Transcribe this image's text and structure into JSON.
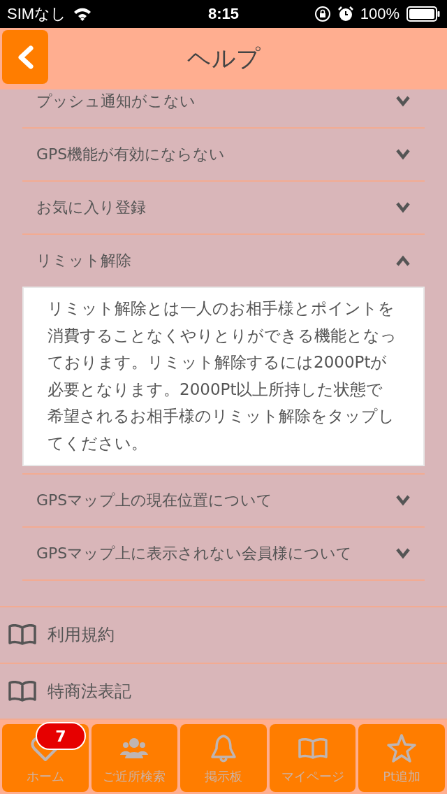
{
  "status_bar": {
    "carrier": "SIMなし",
    "time": "8:15",
    "battery": "100%"
  },
  "header": {
    "title": "ヘルプ"
  },
  "faq": [
    {
      "question": "プッシュ通知がこない",
      "expanded": false
    },
    {
      "question": "GPS機能が有効にならない",
      "expanded": false
    },
    {
      "question": "お気に入り登録",
      "expanded": false
    },
    {
      "question": "リミット解除",
      "expanded": true,
      "answer": "リミット解除とは一人のお相手様とポイントを消費することなくやりとりができる機能となっております。リミット解除するには2000Ptが必要となります。2000Pt以上所持した状態で希望されるお相手様のリミット解除をタップしてください。"
    },
    {
      "question": "GPSマップ上の現在位置について",
      "expanded": false
    },
    {
      "question": "GPSマップ上に表示されない会員様について",
      "expanded": false
    }
  ],
  "links": [
    {
      "label": "利用規約"
    },
    {
      "label": "特商法表記"
    }
  ],
  "tab_bar": [
    {
      "kind": "heart",
      "label": "ホーム",
      "badge": "7"
    },
    {
      "kind": "people",
      "label": "ご近所検索"
    },
    {
      "kind": "bell",
      "label": "掲示板"
    },
    {
      "kind": "book",
      "label": "マイページ"
    },
    {
      "kind": "star",
      "label": "Pt追加"
    }
  ]
}
